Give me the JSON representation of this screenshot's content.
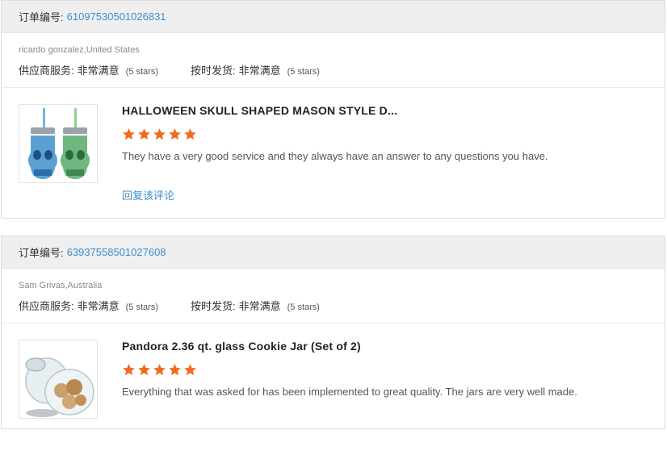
{
  "orders": [
    {
      "order_label": "订单编号:",
      "order_number": "61097530501026831",
      "buyer": "ricardo gonzalez,United States",
      "ratings": [
        {
          "label": "供应商服务:",
          "value": "非常满意",
          "stars_text": "(5 stars)"
        },
        {
          "label": "按时发货:",
          "value": "非常满意",
          "stars_text": "(5 stars)"
        }
      ],
      "product_name": "HALLOWEEN SKULL SHAPED MASON STYLE D...",
      "rating_stars": 5,
      "review": "They have a very good service and they always have an answer to any questions you have.",
      "reply_link": "回复该评论"
    },
    {
      "order_label": "订单编号:",
      "order_number": "63937558501027608",
      "buyer": "Sam Grivas,Australia",
      "ratings": [
        {
          "label": "供应商服务:",
          "value": "非常满意",
          "stars_text": "(5 stars)"
        },
        {
          "label": "按时发货:",
          "value": "非常满意",
          "stars_text": "(5 stars)"
        }
      ],
      "product_name": "Pandora 2.36 qt. glass Cookie Jar (Set of 2)",
      "rating_stars": 5,
      "review": "Everything that was asked for has been implemented to great quality. The jars are very well made."
    }
  ],
  "colors": {
    "star": "#f26b1d",
    "link": "#3a8fd0",
    "header_bg": "#efefef"
  }
}
